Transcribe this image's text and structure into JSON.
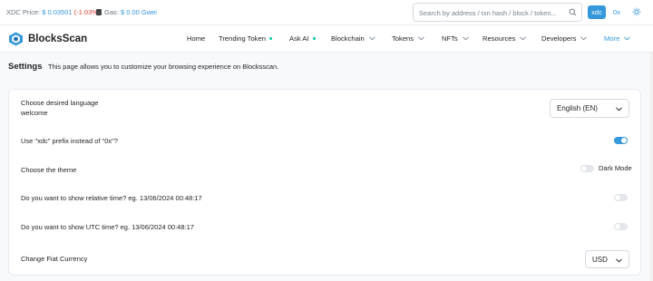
{
  "topbar": {
    "price_label": "XDC Price:",
    "price_value": "$ 0.03501",
    "price_change": "(-1.03%)",
    "gas_label": "Gas:",
    "gas_value": "$ 0.00 Gwei",
    "search_placeholder": "Search by address / txn hash / block / token...",
    "prefix_xdc": "xdc",
    "prefix_0x": "0x"
  },
  "navbar": {
    "brand": "BlocksScan",
    "items": [
      {
        "label": "Home"
      },
      {
        "label": "Trending Token"
      },
      {
        "label": "Ask AI"
      },
      {
        "label": "Blockchain"
      },
      {
        "label": "Tokens"
      },
      {
        "label": "NFTs"
      },
      {
        "label": "Resources"
      },
      {
        "label": "Developers"
      },
      {
        "label": "More"
      }
    ]
  },
  "page": {
    "title": "Settings",
    "description": "This page allows you to customize your browsing experience on Blocksscan."
  },
  "settings": {
    "language_label": "Choose desired language",
    "language_sub": "welcome",
    "language_value": "English (EN)",
    "prefix_label": "Use \"xdc\" prefix instead of \"0x\"?",
    "theme_label": "Choose the theme",
    "theme_toggle_label": "Dark Mode",
    "relative_time_label": "Do you want to show relative time? eg. 13/06/2024 00:48:17",
    "utc_time_label": "Do you want to show UTC time? eg. 13/06/2024 00:48:17",
    "currency_label": "Change Fiat Currency",
    "currency_value": "USD"
  },
  "colors": {
    "accent": "#3498db",
    "negative": "#de4437",
    "live_dot": "#00c9a7"
  }
}
